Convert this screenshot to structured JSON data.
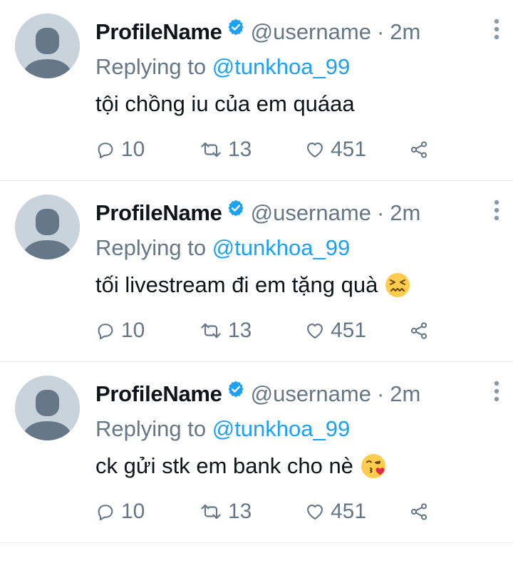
{
  "tweets": [
    {
      "display_name": "ProfileName",
      "handle": "@username",
      "separator": "·",
      "time": "2m",
      "replying_prefix": "Replying to",
      "replying_to": "@tunkhoa_99",
      "text": "tội chồng iu của em quáaa",
      "emoji": "",
      "replies": "10",
      "retweets": "13",
      "likes": "451"
    },
    {
      "display_name": "ProfileName",
      "handle": "@username",
      "separator": "·",
      "time": "2m",
      "replying_prefix": "Replying to",
      "replying_to": "@tunkhoa_99",
      "text": "tối livestream đi em tặng quà",
      "emoji": "confounded-face",
      "replies": "10",
      "retweets": "13",
      "likes": "451"
    },
    {
      "display_name": "ProfileName",
      "handle": "@username",
      "separator": "·",
      "time": "2m",
      "replying_prefix": "Replying to",
      "replying_to": "@tunkhoa_99",
      "text": "ck gửi stk em bank cho nè",
      "emoji": "face-blowing-kiss",
      "replies": "10",
      "retweets": "13",
      "likes": "451"
    }
  ],
  "icons": {
    "avatar": "default-avatar-icon",
    "verified": "verified-badge-icon",
    "more": "more-vertical-icon",
    "reply": "reply-icon",
    "retweet": "retweet-icon",
    "like": "heart-icon",
    "share": "share-icon"
  },
  "colors": {
    "link_blue": "#1da1f2",
    "muted_gray": "#657786",
    "text": "#0f1419",
    "divider": "#e6ecf0",
    "avatar_bg": "#c9d3db",
    "avatar_fg": "#667788"
  }
}
